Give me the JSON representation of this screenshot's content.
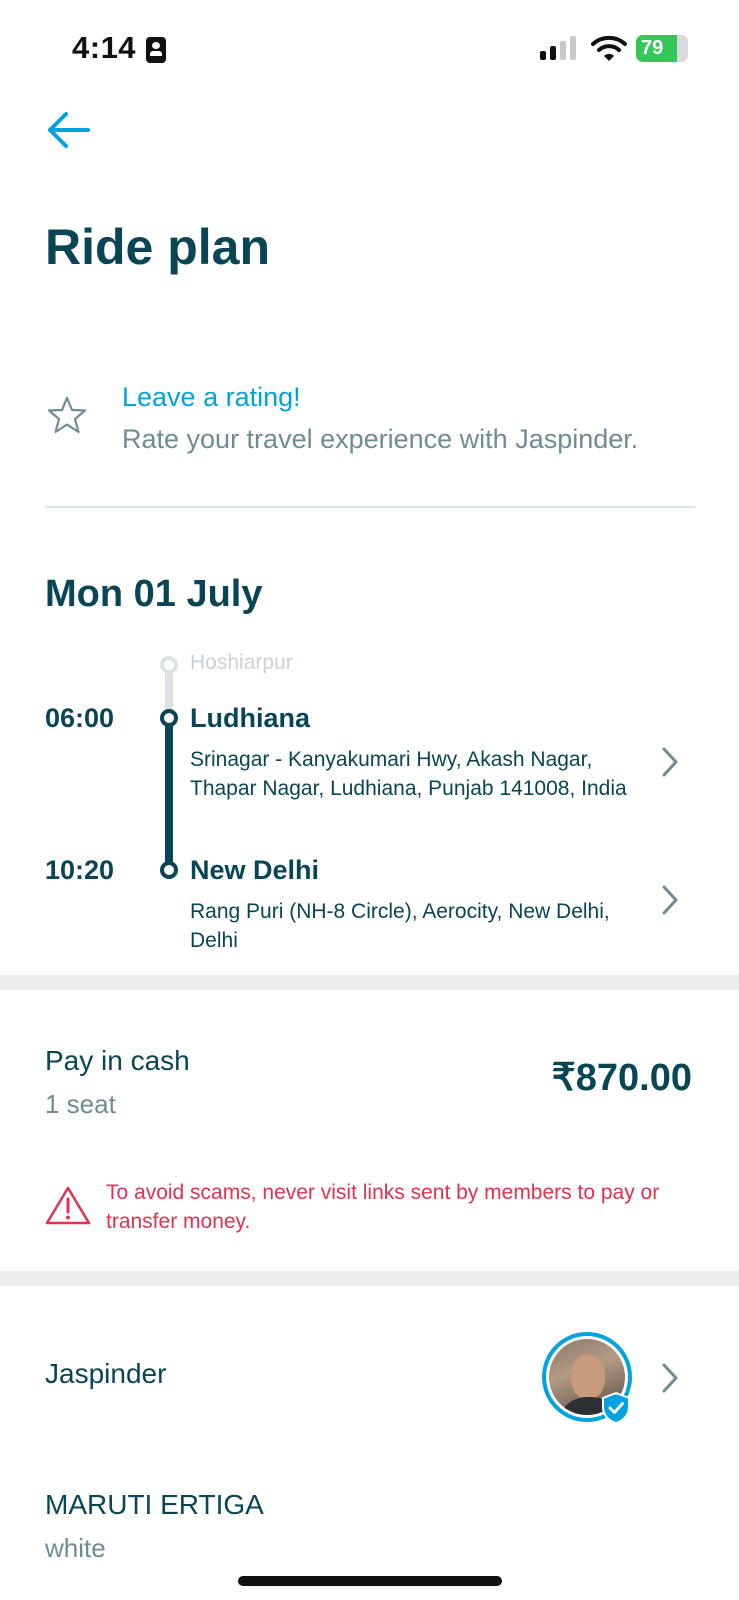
{
  "status_bar": {
    "time": "4:14",
    "battery": "79",
    "battery_level": 0.79,
    "signal_bars": 2,
    "battery_color": "#34c759"
  },
  "header": {
    "back_icon": "arrow-left-icon",
    "title": "Ride plan"
  },
  "rating": {
    "icon": "star-icon",
    "title": "Leave a rating!",
    "subtitle": "Rate your travel experience with Jaspinder."
  },
  "trip": {
    "date": "Mon 01 July",
    "origin_faded": "Hoshiarpur",
    "stops": [
      {
        "time": "06:00",
        "city": "Ludhiana",
        "address": "Srinagar - Kanyakumari Hwy, Akash Nagar, Thapar Nagar, Ludhiana, Punjab 141008, India"
      },
      {
        "time": "10:20",
        "city": "New Delhi",
        "address": "Rang Puri (NH-8 Circle), Aerocity, New Delhi, Delhi"
      }
    ]
  },
  "payment": {
    "method": "Pay in cash",
    "seats": "1 seat",
    "price": "₹870.00",
    "warning": "To avoid scams, never visit links sent by members to pay or transfer money.",
    "warning_color": "#e5304f"
  },
  "driver": {
    "name": "Jaspinder",
    "verified": true
  },
  "car": {
    "model": "MARUTI ERTIGA",
    "color": "white"
  },
  "theme": {
    "primary": "#0a4556",
    "accent": "#00a3e0",
    "muted": "#708c91"
  }
}
